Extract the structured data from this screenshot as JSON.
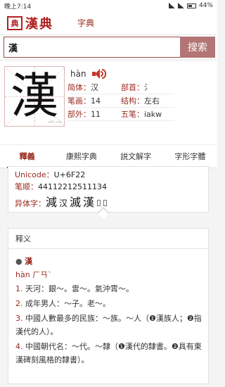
{
  "status_bar": {
    "time": "晚上7:14",
    "battery": "44%"
  },
  "app": {
    "logo_seal": "典",
    "logo_text": "漢典",
    "tab": "字典"
  },
  "search": {
    "value": "漢",
    "button": "搜索"
  },
  "character": {
    "glyph": "漢",
    "watermark": "zdic.net",
    "pinyin": "hàn",
    "info": [
      [
        {
          "key": "简体：",
          "val": "汉"
        },
        {
          "key": "部首：",
          "val": "氵"
        }
      ],
      [
        {
          "key": "笔画：",
          "val": "14"
        },
        {
          "key": "结构：",
          "val": "左右"
        }
      ],
      [
        {
          "key": "部外：",
          "val": "11"
        },
        {
          "key": "五笔：",
          "val": "iakw"
        }
      ]
    ]
  },
  "tabs": [
    "釋義",
    "康熙字典",
    "説文解字",
    "字形字體"
  ],
  "codes": {
    "unicode_label": "Unicode：",
    "unicode_value": "U+6F22",
    "order_label": "笔顺：",
    "order_value": "44112212511134",
    "variant_label": "异体字：",
    "variants": [
      "減",
      "汉",
      "滅",
      "漢"
    ]
  },
  "definition": {
    "heading": "释义",
    "character": "漢",
    "pronunciation": "hàn ㄏㄢˋ",
    "senses": [
      {
        "num": "1.",
        "text": "天河：銀～。雲～。氣沖霄～。"
      },
      {
        "num": "2.",
        "text": "成年男人：～子。老～。"
      },
      {
        "num": "3.",
        "text": "中國人數最多的民族：～族。～人（❶漢族人；❷指漢代的人）。"
      },
      {
        "num": "4.",
        "text": "中國朝代名：～代。～隸（❶漢代的隸書。❷具有東漢碑刻風格的隸書）。"
      }
    ]
  },
  "colors": {
    "accent": "#9b2a20",
    "search_button": "#b37575"
  },
  "icons": {
    "speaker": "speaker-icon",
    "battery": "battery-icon",
    "signal": "signal-icon"
  }
}
